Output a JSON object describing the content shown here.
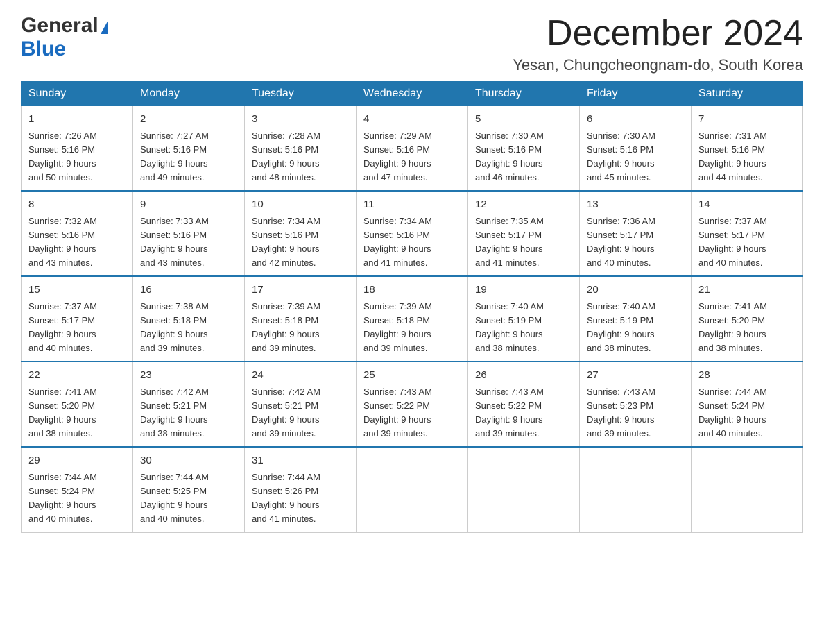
{
  "header": {
    "logo_general": "General",
    "logo_blue": "Blue",
    "month_title": "December 2024",
    "location": "Yesan, Chungcheongnam-do, South Korea"
  },
  "weekdays": [
    "Sunday",
    "Monday",
    "Tuesday",
    "Wednesday",
    "Thursday",
    "Friday",
    "Saturday"
  ],
  "weeks": [
    [
      {
        "day": "1",
        "sunrise": "7:26 AM",
        "sunset": "5:16 PM",
        "daylight": "9 hours and 50 minutes."
      },
      {
        "day": "2",
        "sunrise": "7:27 AM",
        "sunset": "5:16 PM",
        "daylight": "9 hours and 49 minutes."
      },
      {
        "day": "3",
        "sunrise": "7:28 AM",
        "sunset": "5:16 PM",
        "daylight": "9 hours and 48 minutes."
      },
      {
        "day": "4",
        "sunrise": "7:29 AM",
        "sunset": "5:16 PM",
        "daylight": "9 hours and 47 minutes."
      },
      {
        "day": "5",
        "sunrise": "7:30 AM",
        "sunset": "5:16 PM",
        "daylight": "9 hours and 46 minutes."
      },
      {
        "day": "6",
        "sunrise": "7:30 AM",
        "sunset": "5:16 PM",
        "daylight": "9 hours and 45 minutes."
      },
      {
        "day": "7",
        "sunrise": "7:31 AM",
        "sunset": "5:16 PM",
        "daylight": "9 hours and 44 minutes."
      }
    ],
    [
      {
        "day": "8",
        "sunrise": "7:32 AM",
        "sunset": "5:16 PM",
        "daylight": "9 hours and 43 minutes."
      },
      {
        "day": "9",
        "sunrise": "7:33 AM",
        "sunset": "5:16 PM",
        "daylight": "9 hours and 43 minutes."
      },
      {
        "day": "10",
        "sunrise": "7:34 AM",
        "sunset": "5:16 PM",
        "daylight": "9 hours and 42 minutes."
      },
      {
        "day": "11",
        "sunrise": "7:34 AM",
        "sunset": "5:16 PM",
        "daylight": "9 hours and 41 minutes."
      },
      {
        "day": "12",
        "sunrise": "7:35 AM",
        "sunset": "5:17 PM",
        "daylight": "9 hours and 41 minutes."
      },
      {
        "day": "13",
        "sunrise": "7:36 AM",
        "sunset": "5:17 PM",
        "daylight": "9 hours and 40 minutes."
      },
      {
        "day": "14",
        "sunrise": "7:37 AM",
        "sunset": "5:17 PM",
        "daylight": "9 hours and 40 minutes."
      }
    ],
    [
      {
        "day": "15",
        "sunrise": "7:37 AM",
        "sunset": "5:17 PM",
        "daylight": "9 hours and 40 minutes."
      },
      {
        "day": "16",
        "sunrise": "7:38 AM",
        "sunset": "5:18 PM",
        "daylight": "9 hours and 39 minutes."
      },
      {
        "day": "17",
        "sunrise": "7:39 AM",
        "sunset": "5:18 PM",
        "daylight": "9 hours and 39 minutes."
      },
      {
        "day": "18",
        "sunrise": "7:39 AM",
        "sunset": "5:18 PM",
        "daylight": "9 hours and 39 minutes."
      },
      {
        "day": "19",
        "sunrise": "7:40 AM",
        "sunset": "5:19 PM",
        "daylight": "9 hours and 38 minutes."
      },
      {
        "day": "20",
        "sunrise": "7:40 AM",
        "sunset": "5:19 PM",
        "daylight": "9 hours and 38 minutes."
      },
      {
        "day": "21",
        "sunrise": "7:41 AM",
        "sunset": "5:20 PM",
        "daylight": "9 hours and 38 minutes."
      }
    ],
    [
      {
        "day": "22",
        "sunrise": "7:41 AM",
        "sunset": "5:20 PM",
        "daylight": "9 hours and 38 minutes."
      },
      {
        "day": "23",
        "sunrise": "7:42 AM",
        "sunset": "5:21 PM",
        "daylight": "9 hours and 38 minutes."
      },
      {
        "day": "24",
        "sunrise": "7:42 AM",
        "sunset": "5:21 PM",
        "daylight": "9 hours and 39 minutes."
      },
      {
        "day": "25",
        "sunrise": "7:43 AM",
        "sunset": "5:22 PM",
        "daylight": "9 hours and 39 minutes."
      },
      {
        "day": "26",
        "sunrise": "7:43 AM",
        "sunset": "5:22 PM",
        "daylight": "9 hours and 39 minutes."
      },
      {
        "day": "27",
        "sunrise": "7:43 AM",
        "sunset": "5:23 PM",
        "daylight": "9 hours and 39 minutes."
      },
      {
        "day": "28",
        "sunrise": "7:44 AM",
        "sunset": "5:24 PM",
        "daylight": "9 hours and 40 minutes."
      }
    ],
    [
      {
        "day": "29",
        "sunrise": "7:44 AM",
        "sunset": "5:24 PM",
        "daylight": "9 hours and 40 minutes."
      },
      {
        "day": "30",
        "sunrise": "7:44 AM",
        "sunset": "5:25 PM",
        "daylight": "9 hours and 40 minutes."
      },
      {
        "day": "31",
        "sunrise": "7:44 AM",
        "sunset": "5:26 PM",
        "daylight": "9 hours and 41 minutes."
      },
      null,
      null,
      null,
      null
    ]
  ]
}
